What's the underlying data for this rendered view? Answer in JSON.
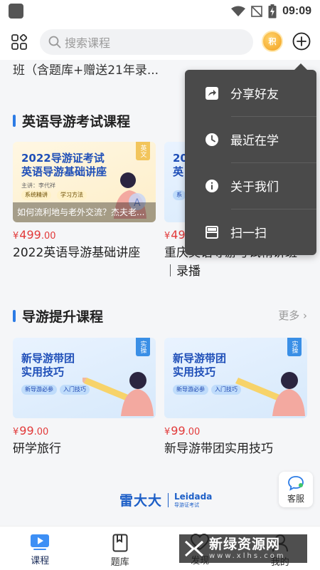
{
  "status_bar": {
    "time": "09:09"
  },
  "header": {
    "search_placeholder": "搜索课程",
    "points_badge": "积"
  },
  "content": {
    "cut_title": "班（含题库+赠送21年录..."
  },
  "section_english": {
    "title": "英语导游考试课程",
    "cards": [
      {
        "thumb_title_line1": "2022导游证考试",
        "thumb_title_line2": "英语导游基础讲座",
        "lecturer": "主讲：李代祥",
        "chips": [
          "系统精讲",
          "学习方法"
        ],
        "tag": "英文",
        "caption": "如何流利地与老外交流？杰夫老...",
        "price_int": "499",
        "price_dec": ".00",
        "currency": "¥",
        "name": "2022英语导游基础讲座"
      },
      {
        "thumb_title_line1": "20",
        "thumb_title_line2": "英",
        "chip": "系",
        "price_int": "49",
        "currency": "¥",
        "name": "重庆英语导游考试精讲班｜录播"
      }
    ]
  },
  "section_improve": {
    "title": "导游提升课程",
    "more": "更多 ›",
    "cards": [
      {
        "thumb_title_line1": "新导游带团",
        "thumb_title_line2": "实用技巧",
        "chips": [
          "新导游必参",
          "入门技巧"
        ],
        "tag": "实操",
        "currency": "¥",
        "price_int": "99",
        "price_dec": ".00",
        "name": "研学旅行"
      },
      {
        "thumb_title_line1": "新导游带团",
        "thumb_title_line2": "实用技巧",
        "chips": [
          "新导游必参",
          "入门技巧"
        ],
        "tag": "实操",
        "currency": "¥",
        "price_int": "99",
        "price_dec": ".00",
        "name": "新导游带团实用技巧"
      }
    ]
  },
  "brand": {
    "cn": "雷大大",
    "en": "Leidada",
    "sub": "导游证考试"
  },
  "service": {
    "label": "客服"
  },
  "bottom_nav": [
    {
      "label": "课程",
      "active": true
    },
    {
      "label": "题库",
      "active": false
    },
    {
      "label": "发现",
      "active": false
    },
    {
      "label": "我的",
      "active": false
    }
  ],
  "popup_menu": [
    {
      "label": "分享好友",
      "icon": "share-icon"
    },
    {
      "label": "最近在学",
      "icon": "clock-icon"
    },
    {
      "label": "关于我们",
      "icon": "info-icon"
    },
    {
      "label": "扫一扫",
      "icon": "scan-icon"
    }
  ],
  "watermark": {
    "cn": "新绿资源网",
    "url": "www.xlhs.com"
  },
  "colors": {
    "accent_blue": "#2c7be5",
    "price_red": "#e23a3a",
    "menu_bg": "#4a4a4a"
  }
}
